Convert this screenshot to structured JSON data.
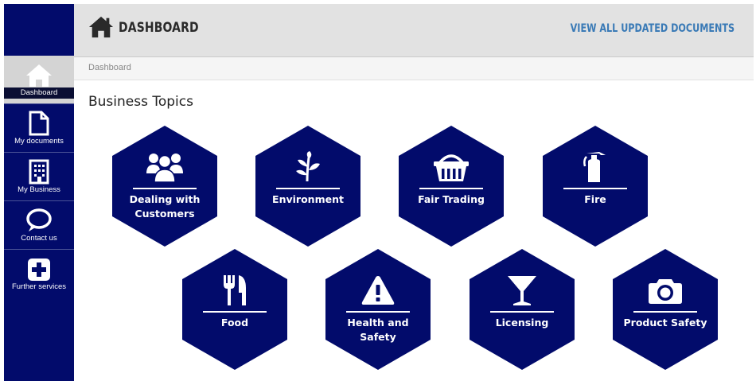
{
  "header": {
    "title": "DASHBOARD",
    "view_all_link": "VIEW ALL UPDATED DOCUMENTS"
  },
  "breadcrumb": {
    "current": "Dashboard"
  },
  "section": {
    "title": "Business Topics"
  },
  "sidebar": {
    "items": [
      {
        "label": "Dashboard",
        "icon": "home-icon",
        "active": true
      },
      {
        "label": "My documents",
        "icon": "document-icon"
      },
      {
        "label": "My Business",
        "icon": "building-icon"
      },
      {
        "label": "Contact us",
        "icon": "speech-bubble-icon"
      },
      {
        "label": "Further services",
        "icon": "plus-icon"
      }
    ]
  },
  "topics": [
    {
      "label": "Dealing with Customers",
      "icon": "people-icon"
    },
    {
      "label": "Environment",
      "icon": "plant-icon"
    },
    {
      "label": "Fair Trading",
      "icon": "basket-icon"
    },
    {
      "label": "Fire",
      "icon": "fire-extinguisher-icon"
    },
    {
      "label": "Food",
      "icon": "cutlery-icon"
    },
    {
      "label": "Health and Safety",
      "icon": "warning-icon"
    },
    {
      "label": "Licensing",
      "icon": "cocktail-glass-icon"
    },
    {
      "label": "Product Safety",
      "icon": "camera-icon"
    }
  ],
  "colors": {
    "navy": "#020b6b",
    "header_bg": "#e2e2e2",
    "link": "#3a7ab6"
  }
}
